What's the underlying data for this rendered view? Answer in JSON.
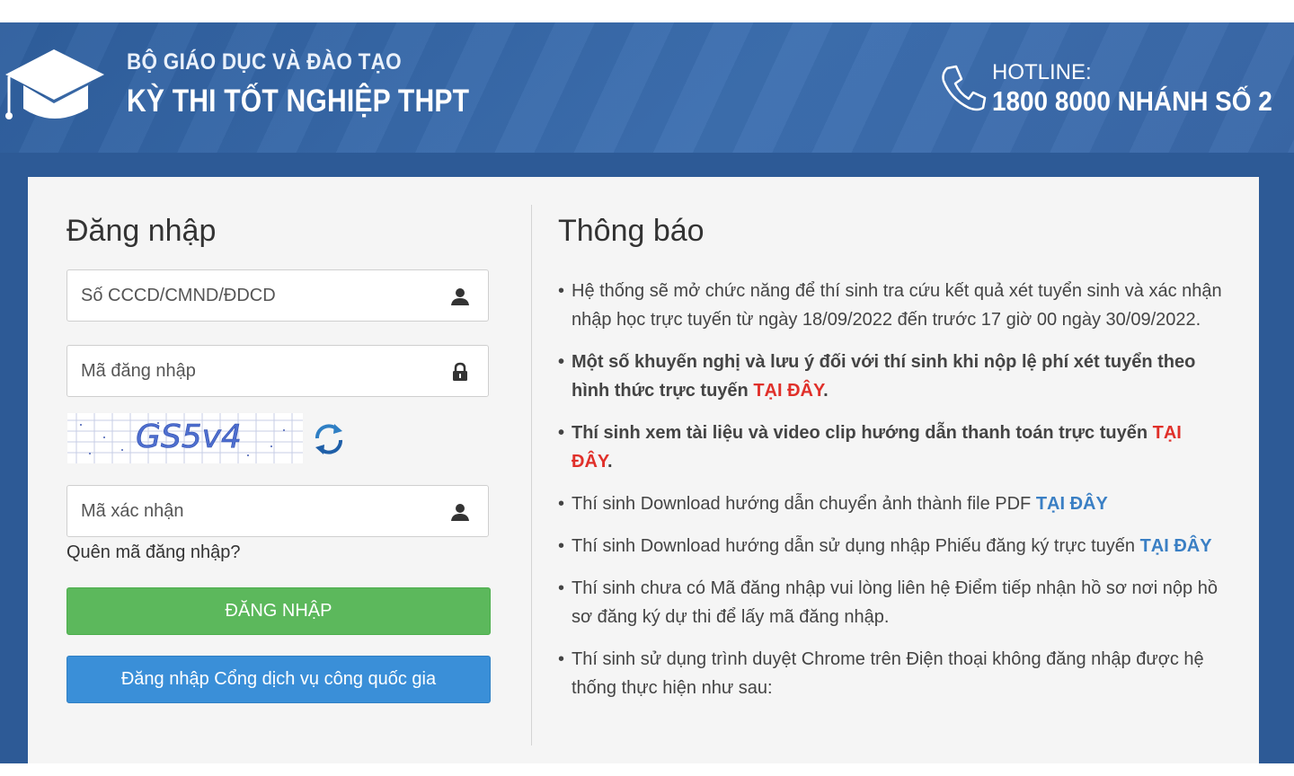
{
  "header": {
    "org": "BỘ GIÁO DỤC VÀ ĐÀO TẠO",
    "exam": "KỲ THI TỐT NGHIỆP THPT",
    "hotline_label": "HOTLINE:",
    "hotline_number": "1800 8000 NHÁNH SỐ 2"
  },
  "login": {
    "title": "Đăng nhập",
    "id_placeholder": "Số CCCD/CMND/ĐDCD",
    "code_placeholder": "Mã đăng nhập",
    "captcha_text": "GS5v4",
    "confirm_placeholder": "Mã xác nhận",
    "forgot": "Quên mã đăng nhập?",
    "login_button": "ĐĂNG NHẬP",
    "gov_button": "Đăng nhập Cổng dịch vụ công quốc gia"
  },
  "notices": {
    "title": "Thông báo",
    "items": [
      {
        "text": "Hệ thống sẽ mở chức năng để thí sinh tra cứu kết quả xét tuyển sinh và xác nhận nhập học trực tuyến từ ngày 18/09/2022 đến trước 17 giờ 00 ngày 30/09/2022."
      },
      {
        "text": "Một số khuyến nghị và lưu ý đối với thí sinh khi nộp lệ phí xét tuyển theo hình thức trực tuyến ",
        "link": "TẠI ĐÂY",
        "after": "."
      },
      {
        "text": "Thí sinh xem tài liệu và video clip hướng dẫn thanh toán trực tuyến ",
        "link": "TẠI ĐÂY",
        "after": "."
      },
      {
        "text": "Thí sinh Download hướng dẫn chuyển ảnh thành file PDF ",
        "link": "TẠI ĐÂY"
      },
      {
        "text": "Thí sinh Download hướng dẫn sử dụng nhập Phiếu đăng ký trực tuyến ",
        "link": "TẠI ĐÂY"
      },
      {
        "text": "Thí sinh chưa có Mã đăng nhập vui lòng liên hệ Điểm tiếp nhận hồ sơ nơi nộp hồ sơ đăng ký dự thi để lấy mã đăng nhập."
      },
      {
        "text": "Thí sinh sử dụng trình duyệt Chrome trên Điện thoại không đăng nhập được hệ thống thực hiện như sau:"
      }
    ]
  },
  "colors": {
    "banner": "#3a68a8",
    "login_button": "#5cb85c",
    "gov_button": "#3a8fd8",
    "link_red": "#e0302a",
    "link_blue": "#3a7fc4"
  }
}
